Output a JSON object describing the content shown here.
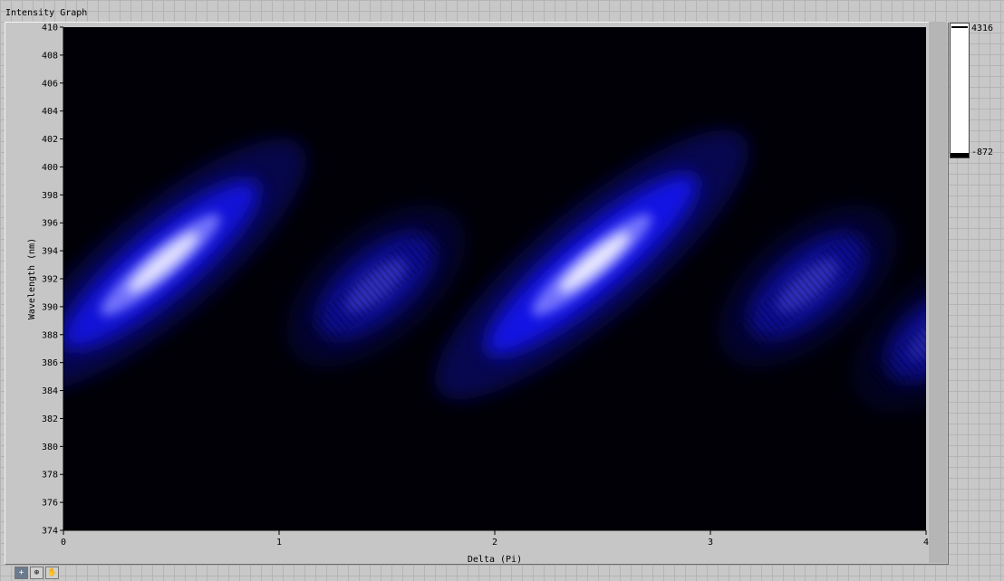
{
  "window": {
    "title": "Intensity Graph"
  },
  "colors": {
    "plot_background": "#000008",
    "peak_blue": "#0000ff",
    "peak_white": "#ffffff"
  },
  "chart_data": {
    "type": "heatmap",
    "title": "Intensity Graph",
    "xlabel": "Delta (Pi)",
    "ylabel": "Wavelength (nm)",
    "xlim": [
      0,
      4
    ],
    "ylim": [
      374,
      410
    ],
    "x_ticks": [
      "0",
      "1",
      "2",
      "3",
      "4"
    ],
    "y_ticks": [
      "374",
      "376",
      "378",
      "380",
      "382",
      "384",
      "386",
      "388",
      "390",
      "392",
      "394",
      "396",
      "398",
      "400",
      "402",
      "404",
      "406",
      "408",
      "410"
    ],
    "colorscale": {
      "max": "4316",
      "min": "-872"
    },
    "blobs": [
      {
        "delta": 0.45,
        "wavelength": 393.0,
        "peak": 4000,
        "color_peak": "white"
      },
      {
        "delta": 1.45,
        "wavelength": 391.5,
        "peak": 2300,
        "color_peak": "blue"
      },
      {
        "delta": 2.45,
        "wavelength": 393.0,
        "peak": 4316,
        "color_peak": "white"
      },
      {
        "delta": 3.45,
        "wavelength": 391.5,
        "peak": 2300,
        "color_peak": "blue"
      },
      {
        "delta": 4.05,
        "wavelength": 388.0,
        "peak": 1500,
        "color_peak": "blue"
      }
    ],
    "grid": false,
    "legend": "colorbar-right"
  },
  "palette": {
    "tools": [
      {
        "name": "cursor-tool-icon",
        "glyph": "+"
      },
      {
        "name": "zoom-tool-icon",
        "glyph": "⊕"
      },
      {
        "name": "pan-tool-icon",
        "glyph": "✋"
      }
    ]
  }
}
